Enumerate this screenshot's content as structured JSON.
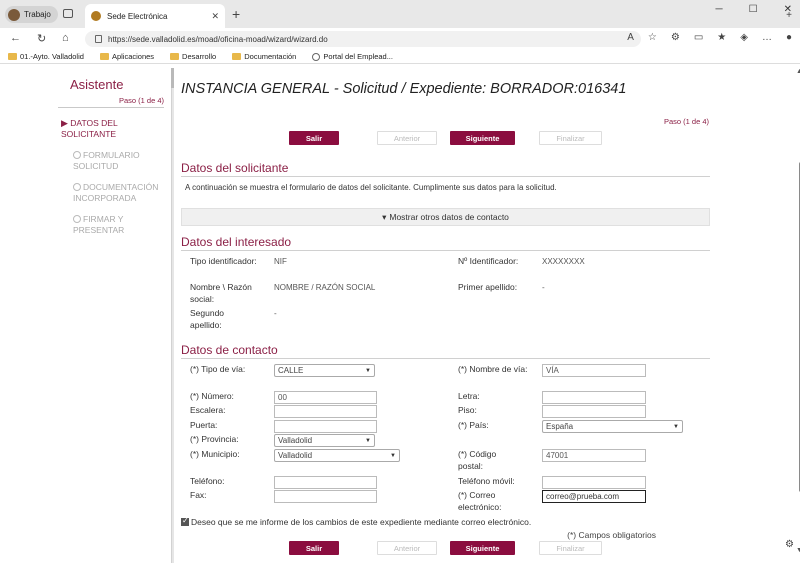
{
  "browser": {
    "profile": "Trabajo",
    "tab_title": "Sede Electrónica",
    "url": "https://sede.valladolid.es/moad/oficina-moad/wizard/wizard.do",
    "bookmarks": [
      "01.-Ayto. Valladolid",
      "Aplicaciones",
      "Desarrollo",
      "Documentación",
      "Portal del Emplead..."
    ]
  },
  "sidebar": {
    "title": "Asistente",
    "step": "Paso (1 de 4)",
    "items": [
      {
        "label": "DATOS DEL SOLICITANTE"
      },
      {
        "label": "FORMULARIO SOLICITUD"
      },
      {
        "label": "DOCUMENTACIÓN INCORPORADA"
      },
      {
        "label": "FIRMAR Y PRESENTAR"
      }
    ]
  },
  "main": {
    "title": "INSTANCIA GENERAL - Solicitud / Expediente: BORRADOR:016341",
    "step": "Paso (1 de 4)",
    "buttons": {
      "exit": "Salir",
      "prev": "Anterior",
      "next": "Siguiente",
      "finish": "Finalizar"
    },
    "applicant_section": "Datos del solicitante",
    "applicant_text": "A continuación se muestra el formulario de datos del solicitante. Cumplimente sus datos para la solicitud.",
    "contact_toggle": "Mostrar otros datos de contacto",
    "interested_section": "Datos del interesado",
    "interested": {
      "id_type_label": "Tipo identificador:",
      "id_type_value": "NIF",
      "id_number_label": "Nº Identificador:",
      "id_number_value": "XXXXXXXX",
      "name_label": "Nombre \\ Razón social:",
      "name_value": "NOMBRE / RAZÓN SOCIAL",
      "surname1_label": "Primer apellido:",
      "surname1_value": "-",
      "surname2_label": "Segundo apellido:",
      "surname2_value": "-"
    },
    "contact_section": "Datos de contacto",
    "contact": {
      "street_type_label": "(*) Tipo de vía:",
      "street_type_value": "CALLE",
      "street_name_label": "(*) Nombre de vía:",
      "street_name_value": "VÍA",
      "number_label": "(*) Número:",
      "number_value": "00",
      "letter_label": "Letra:",
      "stair_label": "Escalera:",
      "floor_label": "Piso:",
      "door_label": "Puerta:",
      "country_label": "(*) País:",
      "country_value": "España",
      "province_label": "(*) Provincia:",
      "province_value": "Valladolid",
      "municipality_label": "(*) Municipio:",
      "municipality_value": "Valladolid",
      "postal_label": "(*) Código postal:",
      "postal_value": "47001",
      "phone_label": "Teléfono:",
      "mobile_label": "Teléfono móvil:",
      "fax_label": "Fax:",
      "email_label": "(*) Correo electrónico:",
      "email_value": "correo@prueba.com"
    },
    "notify_text": "Deseo que se me informe de los cambios de este expediente mediante correo electrónico.",
    "mandatory_note": "(*) Campos obligatorios"
  }
}
